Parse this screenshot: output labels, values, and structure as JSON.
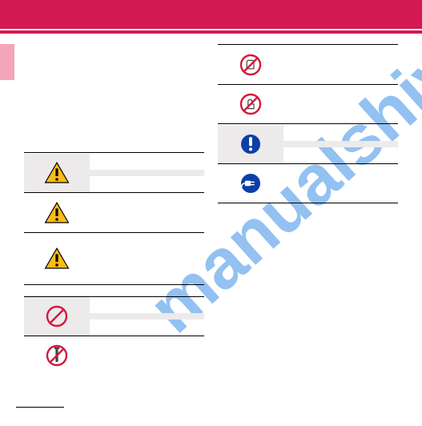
{
  "page": {
    "header_color": "#d31a52",
    "tab_color": "#f4a6b8",
    "watermark_text": "manualshive.com"
  },
  "leftColumn": {
    "rows": [
      {
        "icon": "warning-triangle",
        "bg": "grey",
        "label": ""
      },
      {
        "icon": "warning-triangle",
        "bg": "plain",
        "label": ""
      },
      {
        "icon": "warning-triangle",
        "bg": "plain",
        "label": ""
      },
      {
        "icon": "prohibition",
        "bg": "grey",
        "label": ""
      },
      {
        "icon": "no-disassemble",
        "bg": "plain",
        "label": ""
      }
    ]
  },
  "rightColumn": {
    "rows": [
      {
        "icon": "no-wet-hands",
        "bg": "plain",
        "label": ""
      },
      {
        "icon": "no-touch",
        "bg": "plain",
        "label": ""
      },
      {
        "icon": "mandatory-exclaim",
        "bg": "grey",
        "label": ""
      },
      {
        "icon": "unplug",
        "bg": "plain",
        "label": ""
      }
    ]
  }
}
